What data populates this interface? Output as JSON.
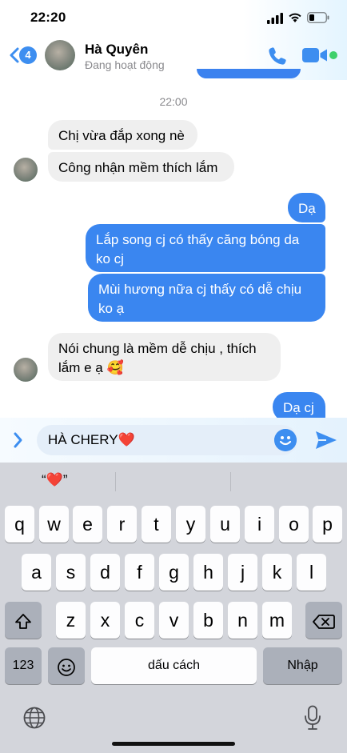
{
  "status_bar": {
    "time": "22:20"
  },
  "header": {
    "back_badge": "4",
    "contact_name": "Hà Quyên",
    "contact_status": "Đang hoạt động",
    "icons": [
      "back-chevron-icon",
      "phone-icon",
      "video-camera-icon",
      "online-dot"
    ],
    "accent_color": "#3d8ef0"
  },
  "chat": {
    "timestamp": "22:00",
    "messages": [
      {
        "side": "in",
        "text": "Chị vừa đắp xong nè"
      },
      {
        "side": "in",
        "text": "Công nhận mềm thích lắm"
      },
      {
        "side": "out",
        "text": "Dạ"
      },
      {
        "side": "out",
        "text": "Lắp song cj có thấy căng bóng da ko cj"
      },
      {
        "side": "out",
        "text": "Mùi hương nữa cj thấy có dễ chịu ko ạ"
      },
      {
        "side": "in",
        "text": "Nói chung là mềm dễ chịu , thích lắm e ạ 🥰"
      },
      {
        "side": "out",
        "text": "Dạ cj"
      }
    ]
  },
  "composer": {
    "text": "HÀ CHERY❤️",
    "icons": [
      "expand-chevron-icon",
      "emoji-icon",
      "send-icon"
    ]
  },
  "keyboard": {
    "suggestion": "“❤️”",
    "row1": [
      "q",
      "w",
      "e",
      "r",
      "t",
      "y",
      "u",
      "i",
      "o",
      "p"
    ],
    "row2": [
      "a",
      "s",
      "d",
      "f",
      "g",
      "h",
      "j",
      "k",
      "l"
    ],
    "row3": [
      "z",
      "x",
      "c",
      "v",
      "b",
      "n",
      "m"
    ],
    "key_123": "123",
    "space": "dấu cách",
    "return": "Nhập",
    "icons": [
      "shift-icon",
      "backspace-icon",
      "emoji-key-icon",
      "globe-icon",
      "microphone-icon"
    ]
  }
}
